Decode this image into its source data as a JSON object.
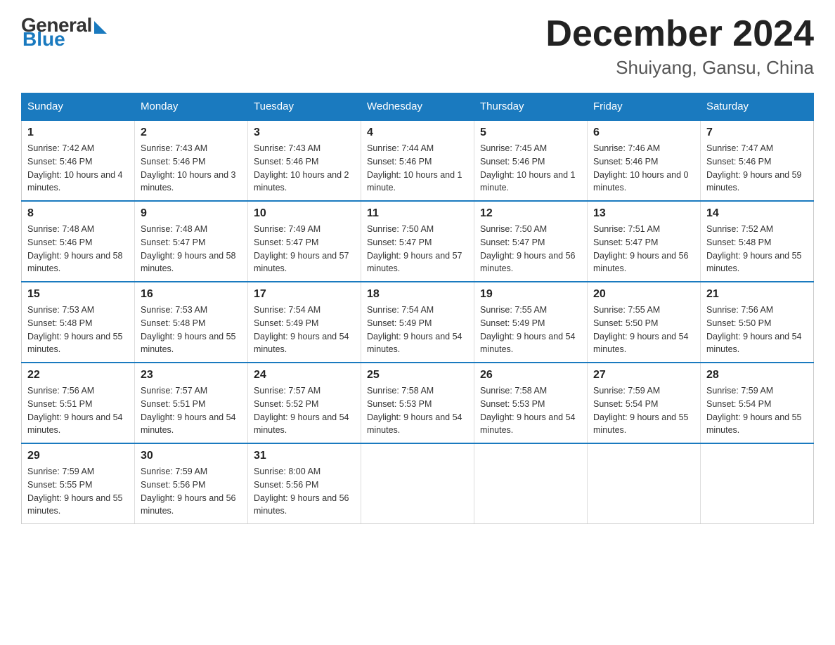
{
  "header": {
    "logo_general": "General",
    "logo_blue": "Blue",
    "month": "December 2024",
    "location": "Shuiyang, Gansu, China"
  },
  "weekdays": [
    "Sunday",
    "Monday",
    "Tuesday",
    "Wednesday",
    "Thursday",
    "Friday",
    "Saturday"
  ],
  "weeks": [
    [
      {
        "day": "1",
        "sunrise": "7:42 AM",
        "sunset": "5:46 PM",
        "daylight": "10 hours and 4 minutes."
      },
      {
        "day": "2",
        "sunrise": "7:43 AM",
        "sunset": "5:46 PM",
        "daylight": "10 hours and 3 minutes."
      },
      {
        "day": "3",
        "sunrise": "7:43 AM",
        "sunset": "5:46 PM",
        "daylight": "10 hours and 2 minutes."
      },
      {
        "day": "4",
        "sunrise": "7:44 AM",
        "sunset": "5:46 PM",
        "daylight": "10 hours and 1 minute."
      },
      {
        "day": "5",
        "sunrise": "7:45 AM",
        "sunset": "5:46 PM",
        "daylight": "10 hours and 1 minute."
      },
      {
        "day": "6",
        "sunrise": "7:46 AM",
        "sunset": "5:46 PM",
        "daylight": "10 hours and 0 minutes."
      },
      {
        "day": "7",
        "sunrise": "7:47 AM",
        "sunset": "5:46 PM",
        "daylight": "9 hours and 59 minutes."
      }
    ],
    [
      {
        "day": "8",
        "sunrise": "7:48 AM",
        "sunset": "5:46 PM",
        "daylight": "9 hours and 58 minutes."
      },
      {
        "day": "9",
        "sunrise": "7:48 AM",
        "sunset": "5:47 PM",
        "daylight": "9 hours and 58 minutes."
      },
      {
        "day": "10",
        "sunrise": "7:49 AM",
        "sunset": "5:47 PM",
        "daylight": "9 hours and 57 minutes."
      },
      {
        "day": "11",
        "sunrise": "7:50 AM",
        "sunset": "5:47 PM",
        "daylight": "9 hours and 57 minutes."
      },
      {
        "day": "12",
        "sunrise": "7:50 AM",
        "sunset": "5:47 PM",
        "daylight": "9 hours and 56 minutes."
      },
      {
        "day": "13",
        "sunrise": "7:51 AM",
        "sunset": "5:47 PM",
        "daylight": "9 hours and 56 minutes."
      },
      {
        "day": "14",
        "sunrise": "7:52 AM",
        "sunset": "5:48 PM",
        "daylight": "9 hours and 55 minutes."
      }
    ],
    [
      {
        "day": "15",
        "sunrise": "7:53 AM",
        "sunset": "5:48 PM",
        "daylight": "9 hours and 55 minutes."
      },
      {
        "day": "16",
        "sunrise": "7:53 AM",
        "sunset": "5:48 PM",
        "daylight": "9 hours and 55 minutes."
      },
      {
        "day": "17",
        "sunrise": "7:54 AM",
        "sunset": "5:49 PM",
        "daylight": "9 hours and 54 minutes."
      },
      {
        "day": "18",
        "sunrise": "7:54 AM",
        "sunset": "5:49 PM",
        "daylight": "9 hours and 54 minutes."
      },
      {
        "day": "19",
        "sunrise": "7:55 AM",
        "sunset": "5:49 PM",
        "daylight": "9 hours and 54 minutes."
      },
      {
        "day": "20",
        "sunrise": "7:55 AM",
        "sunset": "5:50 PM",
        "daylight": "9 hours and 54 minutes."
      },
      {
        "day": "21",
        "sunrise": "7:56 AM",
        "sunset": "5:50 PM",
        "daylight": "9 hours and 54 minutes."
      }
    ],
    [
      {
        "day": "22",
        "sunrise": "7:56 AM",
        "sunset": "5:51 PM",
        "daylight": "9 hours and 54 minutes."
      },
      {
        "day": "23",
        "sunrise": "7:57 AM",
        "sunset": "5:51 PM",
        "daylight": "9 hours and 54 minutes."
      },
      {
        "day": "24",
        "sunrise": "7:57 AM",
        "sunset": "5:52 PM",
        "daylight": "9 hours and 54 minutes."
      },
      {
        "day": "25",
        "sunrise": "7:58 AM",
        "sunset": "5:53 PM",
        "daylight": "9 hours and 54 minutes."
      },
      {
        "day": "26",
        "sunrise": "7:58 AM",
        "sunset": "5:53 PM",
        "daylight": "9 hours and 54 minutes."
      },
      {
        "day": "27",
        "sunrise": "7:59 AM",
        "sunset": "5:54 PM",
        "daylight": "9 hours and 55 minutes."
      },
      {
        "day": "28",
        "sunrise": "7:59 AM",
        "sunset": "5:54 PM",
        "daylight": "9 hours and 55 minutes."
      }
    ],
    [
      {
        "day": "29",
        "sunrise": "7:59 AM",
        "sunset": "5:55 PM",
        "daylight": "9 hours and 55 minutes."
      },
      {
        "day": "30",
        "sunrise": "7:59 AM",
        "sunset": "5:56 PM",
        "daylight": "9 hours and 56 minutes."
      },
      {
        "day": "31",
        "sunrise": "8:00 AM",
        "sunset": "5:56 PM",
        "daylight": "9 hours and 56 minutes."
      },
      null,
      null,
      null,
      null
    ]
  ]
}
